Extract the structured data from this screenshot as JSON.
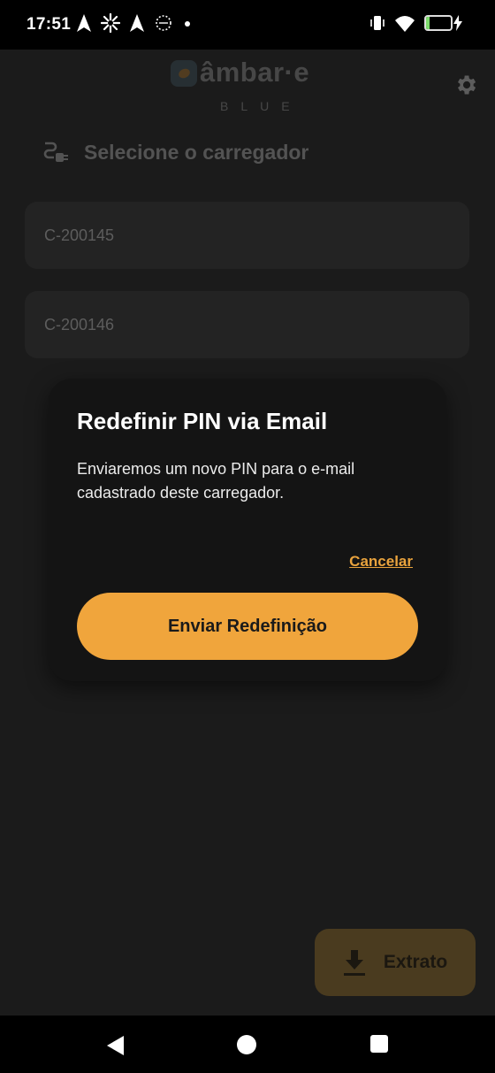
{
  "status_bar": {
    "time": "17:51",
    "battery_level": "14",
    "battery_fraction": 0.14,
    "icons_left": [
      "navigation-arrow-icon",
      "pinwheel-icon",
      "navigation-arrow-icon",
      "circle-badge-icon",
      "dot-icon"
    ],
    "icons_right": [
      "vibrate-icon",
      "wifi-icon",
      "battery-icon",
      "charging-bolt-icon"
    ]
  },
  "app": {
    "logo": {
      "wordmark": "âmbar·e",
      "sub": "BLUE"
    },
    "settings_icon": "gear-icon",
    "section_title": "Selecione o carregador",
    "section_icon": "ev-plug-icon",
    "chargers": [
      {
        "id": "C-200145"
      },
      {
        "id": "C-200146"
      }
    ],
    "fab": {
      "label": "Extrato",
      "icon": "download-icon"
    }
  },
  "dialog": {
    "title": "Redefinir PIN via Email",
    "body": "Enviaremos um novo PIN para o e-mail cadastrado deste carregador.",
    "cancel_label": "Cancelar",
    "primary_label": "Enviar Redefinição"
  },
  "colors": {
    "accent": "#f0a53c",
    "background": "#1b1b1b",
    "dialog_bg": "#141414"
  }
}
